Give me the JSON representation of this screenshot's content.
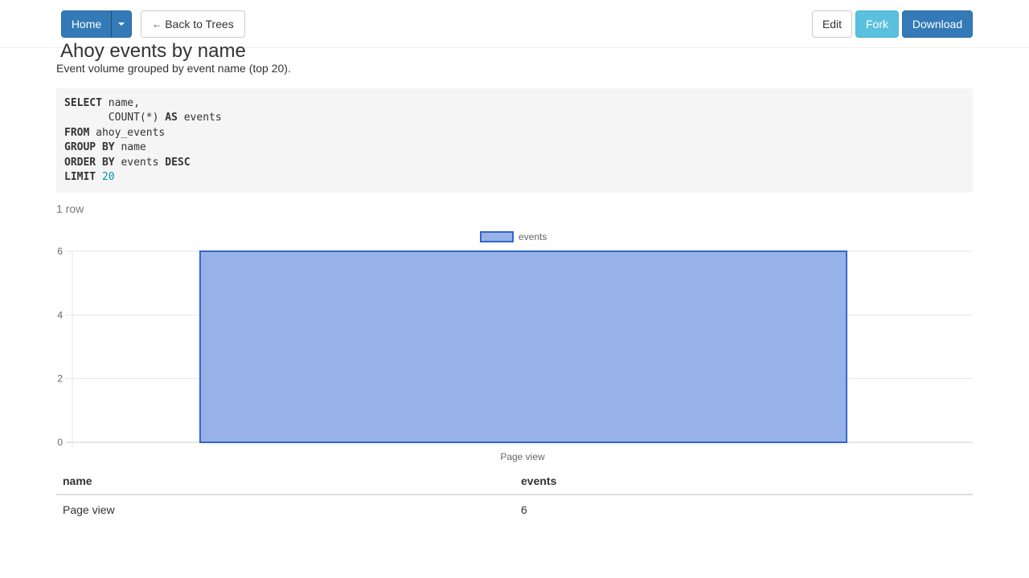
{
  "toolbar": {
    "home_label": "Home",
    "back_label": "Back to Trees",
    "back_arrow": "←",
    "edit_label": "Edit",
    "fork_label": "Fork",
    "download_label": "Download"
  },
  "query": {
    "title": "Ahoy events by name",
    "description": "Event volume grouped by event name (top 20).",
    "sql": {
      "kw_select": "SELECT",
      "line1_rest": " name,",
      "line2_pre": "       COUNT(*) ",
      "kw_as": "AS",
      "line2_rest": " events",
      "kw_from": "FROM",
      "line3_rest": " ahoy_events",
      "kw_group_by": "GROUP BY",
      "line4_rest": " name",
      "kw_order_by": "ORDER BY",
      "line5_mid": " events ",
      "kw_desc": "DESC",
      "kw_limit": "LIMIT",
      "limit_value": "20"
    },
    "row_count": "1 row"
  },
  "colors": {
    "bar_fill": "#97b2e6",
    "bar_stroke": "#3366cc",
    "primary": "#337ab7",
    "info": "#5bc0de"
  },
  "chart_data": {
    "type": "bar",
    "categories": [
      "Page view"
    ],
    "series": [
      {
        "name": "events",
        "values": [
          6
        ]
      }
    ],
    "ylim": [
      0,
      6
    ],
    "yticks": [
      0,
      2,
      4,
      6
    ],
    "grid": true,
    "legend": "top-center"
  },
  "table": {
    "headers": [
      "name",
      "events"
    ],
    "rows": [
      [
        "Page view",
        "6"
      ]
    ]
  }
}
